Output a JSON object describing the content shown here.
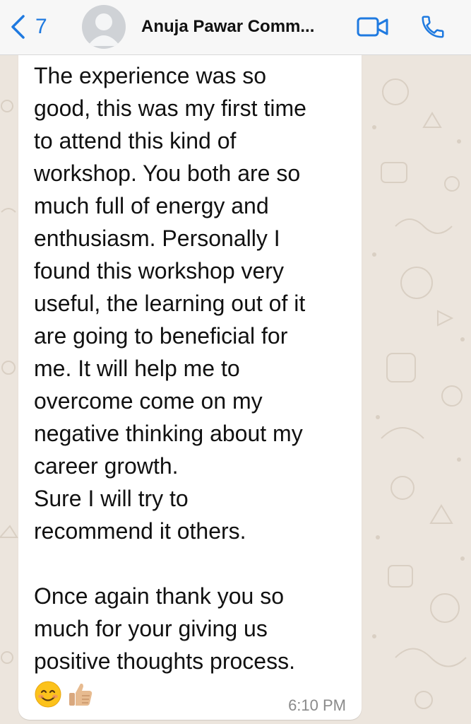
{
  "header": {
    "back_count": "7",
    "contact_name": "Anuja Pawar Comm...",
    "icons": {
      "back": "chevron-left-icon",
      "avatar": "default-avatar-icon",
      "video": "video-camera-icon",
      "call": "phone-icon"
    }
  },
  "message": {
    "lines": [
      "The experience was so",
      "good, this was my first time",
      "to attend this kind of",
      "workshop. You both are so",
      "much full of energy and",
      "enthusiasm. Personally I",
      "found this workshop very",
      "useful, the learning out of it",
      "are going to beneficial for",
      "me. It will help me to",
      "overcome come on my",
      "negative thinking about my",
      "career growth.",
      "Sure I will try to",
      "recommend it others.",
      "",
      "Once again thank you so",
      "much for your giving us",
      "positive thoughts process."
    ],
    "emojis": [
      "smiling-face-emoji",
      "thumbs-up-emoji"
    ],
    "time": "6:10 PM"
  },
  "colors": {
    "accent": "#1f7ae0",
    "chat_background": "#ece5dd",
    "bubble": "#ffffff",
    "header": "#f7f7f7",
    "timestamp": "#8a8a8a"
  }
}
